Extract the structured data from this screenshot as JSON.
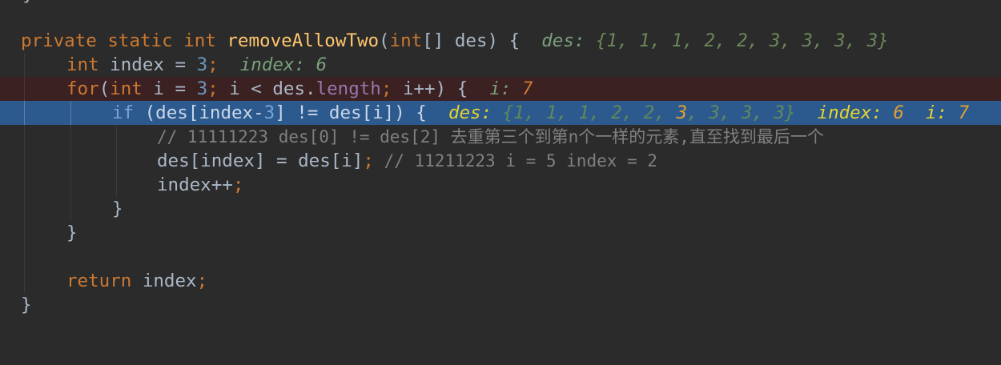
{
  "editor": {
    "signature": {
      "kw_private": "private",
      "kw_static": "static",
      "kw_int": "int",
      "method": "removeAllowTwo",
      "open_paren": "(",
      "param_type": "int",
      "param_rest": "[] des) {",
      "hint_name": "des:",
      "hint_value": "{1, 1, 1, 2, 2, 3, 3, 3, 3}"
    },
    "line_index": {
      "kw_int": "int",
      "text_a": " index = ",
      "value": "3",
      "semi": ";",
      "hint": "index: 6"
    },
    "line_for": {
      "kw_for": "for",
      "open": "(",
      "kw_int": "int",
      "text_a": " i = ",
      "value": "3",
      "semi1": ";",
      "text_b": " i < des.",
      "field": "length",
      "semi2": ";",
      "text_c": " i++) {",
      "hint_name": "i:",
      "hint_value": "7"
    },
    "line_if": {
      "kw_if": "if",
      "text_a": " (des[index-",
      "value": "3",
      "text_b": "] != des[i]) {",
      "hint1_name": "des:",
      "hint1_dim": "{1, 1, 1, 2, 2, ",
      "hint1_hi": "3",
      "hint1_rest": ", 3, 3, 3}",
      "hint2_name": "index:",
      "hint2_value": "6",
      "hint3_name": "i:",
      "hint3_value": "7"
    },
    "comment1": "// 11111223 des[0] != des[2] 去重第三个到第n个一样的元素,直至找到最后一个",
    "line_assign": {
      "text": "des[index] = des[i]",
      "semi": ";",
      "comment": " // 11211223 i = 5 index = 2"
    },
    "line_incr": {
      "text": "index++",
      "semi": ";"
    },
    "brace1": "}",
    "brace2": "}",
    "line_return": {
      "kw_return": "return",
      "text": " index",
      "semi": ";"
    },
    "brace3": "}",
    "top_brace": "}"
  }
}
